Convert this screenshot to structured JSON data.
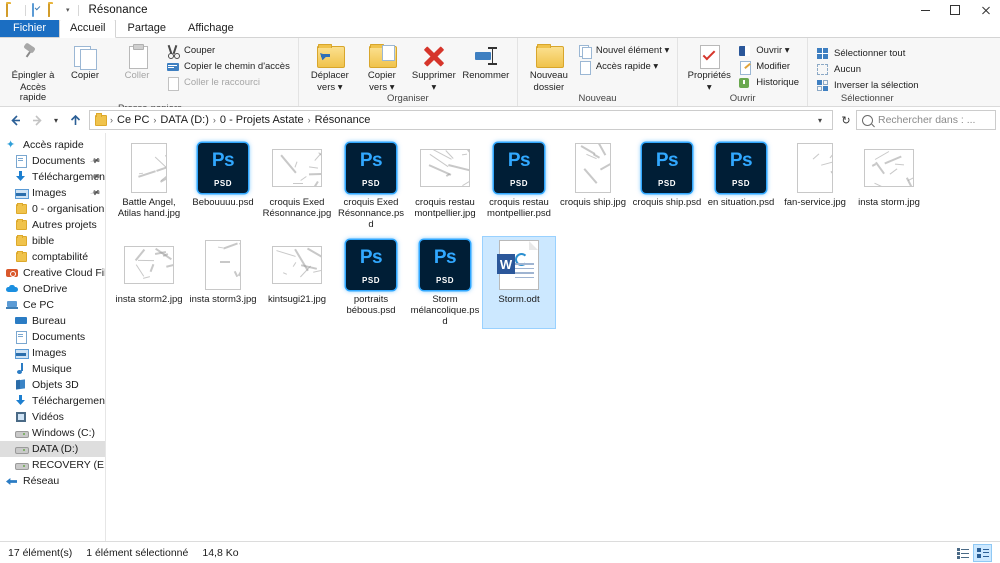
{
  "window": {
    "title": "Résonance",
    "quick_access_icons": [
      "folder-icon",
      "properties-checkbox-icon",
      "new-folder-icon"
    ],
    "quick_access_dropdown": "▾",
    "minimize": "minimize-icon",
    "maximize": "maximize-icon",
    "close": "close-icon"
  },
  "tabs": [
    {
      "label": "Fichier",
      "type": "file"
    },
    {
      "label": "Accueil",
      "type": "active"
    },
    {
      "label": "Partage",
      "type": "normal"
    },
    {
      "label": "Affichage",
      "type": "normal"
    }
  ],
  "ribbon": {
    "groups": [
      {
        "name": "Presse-papiers",
        "big": [
          {
            "label_line1": "Épingler à",
            "label_line2": "Accès rapide",
            "icon": "pin-icon",
            "dim": false
          },
          {
            "label_line1": "Copier",
            "label_line2": "",
            "icon": "copy-icon",
            "dim": false
          },
          {
            "label_line1": "Coller",
            "label_line2": "",
            "icon": "paste-icon",
            "dim": true
          }
        ],
        "small": [
          {
            "label": "Couper",
            "icon": "cut-icon",
            "dim": false
          },
          {
            "label": "Copier le chemin d'accès",
            "icon": "copy-path-icon",
            "dim": false
          },
          {
            "label": "Coller le raccourci",
            "icon": "paste-shortcut-icon",
            "dim": true
          }
        ]
      },
      {
        "name": "Organiser",
        "big": [
          {
            "label_line1": "Déplacer",
            "label_line2": "vers ▾",
            "icon": "move-to-icon",
            "dim": false
          },
          {
            "label_line1": "Copier",
            "label_line2": "vers ▾",
            "icon": "copy-to-icon",
            "dim": false
          },
          {
            "label_line1": "Supprimer",
            "label_line2": "▾",
            "icon": "delete-icon",
            "dim": false
          },
          {
            "label_line1": "Renommer",
            "label_line2": "",
            "icon": "rename-icon",
            "dim": false
          }
        ],
        "small": []
      },
      {
        "name": "Nouveau",
        "big": [
          {
            "label_line1": "Nouveau",
            "label_line2": "dossier",
            "icon": "new-folder-icon",
            "dim": false
          }
        ],
        "small": [
          {
            "label": "Nouvel élément ▾",
            "icon": "new-item-icon",
            "dim": false
          },
          {
            "label": "Accès rapide ▾",
            "icon": "easy-access-icon",
            "dim": false
          }
        ]
      },
      {
        "name": "Ouvrir",
        "big": [
          {
            "label_line1": "Propriétés",
            "label_line2": "▾",
            "icon": "properties-icon",
            "dim": false
          }
        ],
        "small": [
          {
            "label": "Ouvrir ▾",
            "icon": "open-icon",
            "dim": false
          },
          {
            "label": "Modifier",
            "icon": "edit-icon",
            "dim": false
          },
          {
            "label": "Historique",
            "icon": "history-icon",
            "dim": false
          }
        ]
      },
      {
        "name": "Sélectionner",
        "big": [],
        "small": [
          {
            "label": "Sélectionner tout",
            "icon": "select-all-icon",
            "dim": false
          },
          {
            "label": "Aucun",
            "icon": "select-none-icon",
            "dim": false
          },
          {
            "label": "Inverser la sélection",
            "icon": "invert-selection-icon",
            "dim": false
          }
        ]
      }
    ]
  },
  "addressbar": {
    "back": "◄",
    "forward": "►",
    "recent": "▾",
    "up": "▲",
    "crumbs": [
      "Ce PC",
      "DATA (D:)",
      "0 - Projets Astate",
      "Résonance"
    ],
    "crumb_dropdown": "▾",
    "refresh": "↻",
    "search_placeholder": "Rechercher dans : ..."
  },
  "navigation": {
    "items": [
      {
        "label": "Accès rapide",
        "icon": "quick-access-star-icon",
        "indent": 0,
        "pinned": false,
        "selected": false
      },
      {
        "label": "Documents",
        "icon": "documents-icon",
        "indent": 1,
        "pinned": true,
        "selected": false
      },
      {
        "label": "Téléchargements",
        "icon": "downloads-icon",
        "indent": 1,
        "pinned": true,
        "selected": false
      },
      {
        "label": "Images",
        "icon": "pictures-icon",
        "indent": 1,
        "pinned": true,
        "selected": false
      },
      {
        "label": "0 - organisation",
        "icon": "folder-icon",
        "indent": 1,
        "pinned": false,
        "selected": false
      },
      {
        "label": "Autres projets",
        "icon": "folder-icon",
        "indent": 1,
        "pinned": false,
        "selected": false
      },
      {
        "label": "bible",
        "icon": "folder-icon",
        "indent": 1,
        "pinned": false,
        "selected": false
      },
      {
        "label": "comptabilité",
        "icon": "folder-icon",
        "indent": 1,
        "pinned": false,
        "selected": false
      },
      {
        "label": "Creative Cloud Files",
        "icon": "creative-cloud-icon",
        "indent": 0,
        "pinned": false,
        "selected": false
      },
      {
        "label": "OneDrive",
        "icon": "onedrive-icon",
        "indent": 0,
        "pinned": false,
        "selected": false
      },
      {
        "label": "Ce PC",
        "icon": "this-pc-icon",
        "indent": 0,
        "pinned": false,
        "selected": false
      },
      {
        "label": "Bureau",
        "icon": "desktop-icon",
        "indent": 1,
        "pinned": false,
        "selected": false
      },
      {
        "label": "Documents",
        "icon": "documents-icon",
        "indent": 1,
        "pinned": false,
        "selected": false
      },
      {
        "label": "Images",
        "icon": "pictures-icon",
        "indent": 1,
        "pinned": false,
        "selected": false
      },
      {
        "label": "Musique",
        "icon": "music-icon",
        "indent": 1,
        "pinned": false,
        "selected": false
      },
      {
        "label": "Objets 3D",
        "icon": "objects-3d-icon",
        "indent": 1,
        "pinned": false,
        "selected": false
      },
      {
        "label": "Téléchargements",
        "icon": "downloads-icon",
        "indent": 1,
        "pinned": false,
        "selected": false
      },
      {
        "label": "Vidéos",
        "icon": "videos-icon",
        "indent": 1,
        "pinned": false,
        "selected": false
      },
      {
        "label": "Windows (C:)",
        "icon": "drive-icon",
        "indent": 1,
        "pinned": false,
        "selected": false
      },
      {
        "label": "DATA (D:)",
        "icon": "drive-icon",
        "indent": 1,
        "pinned": false,
        "selected": true
      },
      {
        "label": "RECOVERY (E:)",
        "icon": "drive-icon",
        "indent": 1,
        "pinned": false,
        "selected": false
      },
      {
        "label": "Réseau",
        "icon": "network-icon",
        "indent": 0,
        "pinned": false,
        "selected": false
      }
    ]
  },
  "files": [
    {
      "name": "Battle Angel, Atilas hand.jpg",
      "type": "photo",
      "selected": false
    },
    {
      "name": "Bebouuuu.psd",
      "type": "psd",
      "selected": false
    },
    {
      "name": "croquis Exed Résonnance.jpg",
      "type": "photo",
      "selected": false
    },
    {
      "name": "croquis Exed Résonnance.psd",
      "type": "psd",
      "selected": false
    },
    {
      "name": "croquis restau montpellier.jpg",
      "type": "photo",
      "selected": false
    },
    {
      "name": "croquis restau montpellier.psd",
      "type": "psd",
      "selected": false
    },
    {
      "name": "croquis ship.jpg",
      "type": "photo",
      "selected": false
    },
    {
      "name": "croquis ship.psd",
      "type": "psd",
      "selected": false
    },
    {
      "name": "en situation.psd",
      "type": "psd",
      "selected": false
    },
    {
      "name": "fan-service.jpg",
      "type": "photo",
      "selected": false
    },
    {
      "name": "insta storm.jpg",
      "type": "photo",
      "selected": false
    },
    {
      "name": "insta storm2.jpg",
      "type": "photo",
      "selected": false
    },
    {
      "name": "insta storm3.jpg",
      "type": "photo",
      "selected": false
    },
    {
      "name": "kintsugi21.jpg",
      "type": "photo",
      "selected": false
    },
    {
      "name": "portraits bébous.psd",
      "type": "psd",
      "selected": false
    },
    {
      "name": "Storm mélancolique.psd",
      "type": "psd",
      "selected": false
    },
    {
      "name": "Storm.odt",
      "type": "odt",
      "selected": true
    }
  ],
  "psd_icon": {
    "ps": "Ps",
    "label": "PSD"
  },
  "odt_icon": {
    "badge": "W"
  },
  "status": {
    "item_count": "17 élément(s)",
    "selection": "1 élément sélectionné",
    "size": "14,8 Ko",
    "view_details": "details-view-icon",
    "view_large_icons": "large-icons-view-icon"
  },
  "colors": {
    "file_tab": "#1b6ec2",
    "selection": "#cce8ff",
    "psd_bg": "#001e36",
    "psd_accent": "#31a8ff",
    "word_blue": "#2b579a"
  }
}
